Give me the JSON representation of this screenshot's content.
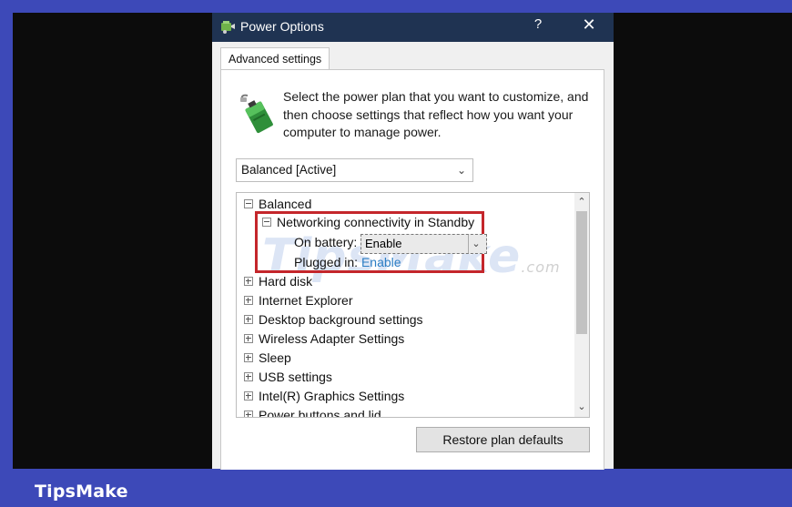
{
  "window": {
    "title": "Power Options",
    "help_glyph": "?",
    "close_glyph": "✕",
    "icon": "power-options-icon"
  },
  "tab": {
    "label": "Advanced settings"
  },
  "intro": {
    "icon": "battery-plug-icon",
    "text": "Select the power plan that you want to customize, and then choose settings that reflect how you want your computer to manage power."
  },
  "plan_select": {
    "value": "Balanced [Active]",
    "chevron": "chevron-down-icon"
  },
  "tree": {
    "root": {
      "label": "Balanced",
      "expanded": true
    },
    "networking": {
      "label": "Networking connectivity in Standby",
      "expanded": true,
      "on_battery": {
        "label": "On battery:",
        "value": "Enable"
      },
      "plugged_in": {
        "label": "Plugged in:",
        "value": "Enable"
      }
    },
    "items": [
      {
        "label": "Hard disk"
      },
      {
        "label": "Internet Explorer"
      },
      {
        "label": "Desktop background settings"
      },
      {
        "label": "Wireless Adapter Settings"
      },
      {
        "label": "Sleep"
      },
      {
        "label": "USB settings"
      },
      {
        "label": "Intel(R) Graphics Settings"
      },
      {
        "label": "Power buttons and lid"
      }
    ]
  },
  "watermark": {
    "text": "TipsMake",
    "suffix": ".com"
  },
  "restore_button": {
    "label": "Restore plan defaults"
  },
  "footer": {
    "brand": "TipsMake"
  },
  "colors": {
    "titlebar": "#1f3352",
    "highlight_border": "#c4262b",
    "footer_band": "#3d49b8",
    "link": "#2c7ec4"
  }
}
